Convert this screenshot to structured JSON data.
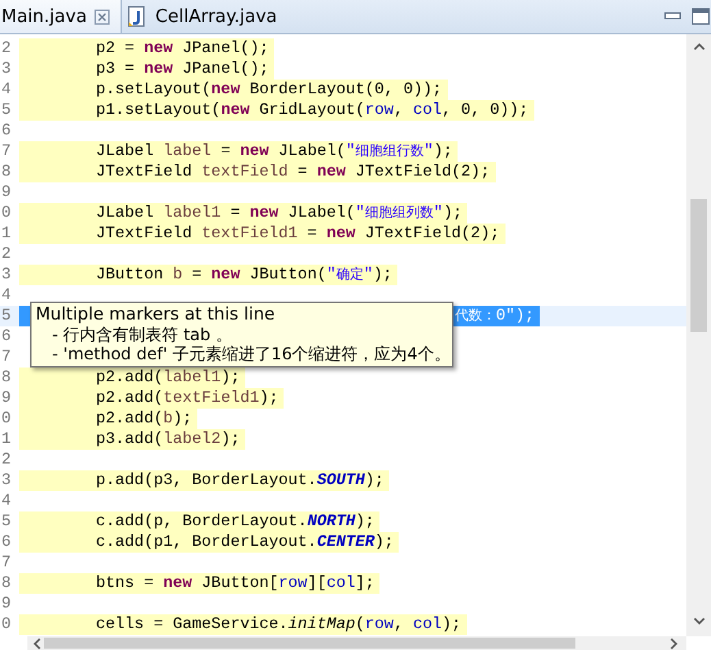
{
  "tabs": [
    {
      "label": "Main.java",
      "selected": true
    },
    {
      "label": "CellArray.java",
      "selected": false
    }
  ],
  "editor": {
    "lines": [
      {
        "number": "2",
        "highlighted": true,
        "selected": false,
        "code": [
          {
            "kind": "text",
            "t": "p2 = "
          },
          {
            "kind": "keyword",
            "t": "new"
          },
          {
            "kind": "text",
            "t": " JPanel();"
          }
        ]
      },
      {
        "number": "3",
        "highlighted": true,
        "selected": false,
        "code": [
          {
            "kind": "text",
            "t": "p3 = "
          },
          {
            "kind": "keyword",
            "t": "new"
          },
          {
            "kind": "text",
            "t": " JPanel();"
          }
        ]
      },
      {
        "number": "4",
        "highlighted": true,
        "selected": false,
        "code": [
          {
            "kind": "text",
            "t": "p.setLayout("
          },
          {
            "kind": "keyword",
            "t": "new"
          },
          {
            "kind": "text",
            "t": " BorderLayout(0, 0));"
          }
        ]
      },
      {
        "number": "5",
        "highlighted": true,
        "selected": false,
        "code": [
          {
            "kind": "text",
            "t": "p1.setLayout("
          },
          {
            "kind": "keyword",
            "t": "new"
          },
          {
            "kind": "text",
            "t": " GridLayout("
          },
          {
            "kind": "field",
            "t": "row"
          },
          {
            "kind": "text",
            "t": ", "
          },
          {
            "kind": "field",
            "t": "col"
          },
          {
            "kind": "text",
            "t": ", 0, 0));"
          }
        ]
      },
      {
        "number": "6"
      },
      {
        "number": "7",
        "highlighted": true,
        "selected": false,
        "code": [
          {
            "kind": "text",
            "t": "JLabel "
          },
          {
            "kind": "local",
            "t": "label"
          },
          {
            "kind": "text",
            "t": " = "
          },
          {
            "kind": "keyword",
            "t": "new"
          },
          {
            "kind": "text",
            "t": " JLabel("
          },
          {
            "kind": "string",
            "t": "\""
          },
          {
            "kind": "cjk",
            "t": "细胞组行数"
          },
          {
            "kind": "string",
            "t": "\""
          },
          {
            "kind": "text",
            "t": ");"
          }
        ]
      },
      {
        "number": "8",
        "highlighted": true,
        "selected": false,
        "code": [
          {
            "kind": "text",
            "t": "JTextField "
          },
          {
            "kind": "local",
            "t": "textField"
          },
          {
            "kind": "text",
            "t": " = "
          },
          {
            "kind": "keyword",
            "t": "new"
          },
          {
            "kind": "text",
            "t": " JTextField(2);"
          }
        ]
      },
      {
        "number": "9"
      },
      {
        "number": "0",
        "highlighted": true,
        "selected": false,
        "code": [
          {
            "kind": "text",
            "t": "JLabel "
          },
          {
            "kind": "local",
            "t": "label1"
          },
          {
            "kind": "text",
            "t": " = "
          },
          {
            "kind": "keyword",
            "t": "new"
          },
          {
            "kind": "text",
            "t": " JLabel("
          },
          {
            "kind": "string",
            "t": "\""
          },
          {
            "kind": "cjk",
            "t": "细胞组列数"
          },
          {
            "kind": "string",
            "t": "\""
          },
          {
            "kind": "text",
            "t": ");"
          }
        ]
      },
      {
        "number": "1",
        "highlighted": true,
        "selected": false,
        "code": [
          {
            "kind": "text",
            "t": "JTextField "
          },
          {
            "kind": "local",
            "t": "textField1"
          },
          {
            "kind": "text",
            "t": " = "
          },
          {
            "kind": "keyword",
            "t": "new"
          },
          {
            "kind": "text",
            "t": " JTextField(2);"
          }
        ]
      },
      {
        "number": "2"
      },
      {
        "number": "3",
        "highlighted": true,
        "selected": false,
        "code": [
          {
            "kind": "text",
            "t": "JButton "
          },
          {
            "kind": "local",
            "t": "b"
          },
          {
            "kind": "text",
            "t": " = "
          },
          {
            "kind": "keyword",
            "t": "new"
          },
          {
            "kind": "text",
            "t": " JButton("
          },
          {
            "kind": "string",
            "t": "\""
          },
          {
            "kind": "cjk",
            "t": "确定"
          },
          {
            "kind": "string",
            "t": "\""
          },
          {
            "kind": "text",
            "t": ");"
          }
        ]
      },
      {
        "number": "4"
      },
      {
        "number": "5",
        "highlighted": true,
        "selected": true,
        "covered": true,
        "code": [
          {
            "kind": "cjk",
            "t": "代数："
          },
          {
            "kind": "string",
            "t": "0\""
          },
          {
            "kind": "text",
            "t": ");"
          }
        ]
      },
      {
        "number": "6"
      },
      {
        "number": "7"
      },
      {
        "number": "8",
        "highlighted": true,
        "selected": false,
        "code": [
          {
            "kind": "text",
            "t": "p2.add("
          },
          {
            "kind": "local",
            "t": "label1"
          },
          {
            "kind": "text",
            "t": ");"
          }
        ]
      },
      {
        "number": "9",
        "highlighted": true,
        "selected": false,
        "code": [
          {
            "kind": "text",
            "t": "p2.add("
          },
          {
            "kind": "local",
            "t": "textField1"
          },
          {
            "kind": "text",
            "t": ");"
          }
        ]
      },
      {
        "number": "0",
        "highlighted": true,
        "selected": false,
        "code": [
          {
            "kind": "text",
            "t": "p2.add("
          },
          {
            "kind": "local",
            "t": "b"
          },
          {
            "kind": "text",
            "t": ");"
          }
        ]
      },
      {
        "number": "1",
        "highlighted": true,
        "selected": false,
        "code": [
          {
            "kind": "text",
            "t": "p3.add("
          },
          {
            "kind": "local",
            "t": "label2"
          },
          {
            "kind": "text",
            "t": ");"
          }
        ]
      },
      {
        "number": "2"
      },
      {
        "number": "3",
        "highlighted": true,
        "selected": false,
        "code": [
          {
            "kind": "text",
            "t": "p.add(p3, BorderLayout."
          },
          {
            "kind": "constant",
            "t": "SOUTH"
          },
          {
            "kind": "text",
            "t": ");"
          }
        ]
      },
      {
        "number": "4"
      },
      {
        "number": "5",
        "highlighted": true,
        "selected": false,
        "code": [
          {
            "kind": "text",
            "t": "c.add(p, BorderLayout."
          },
          {
            "kind": "constant",
            "t": "NORTH"
          },
          {
            "kind": "text",
            "t": ");"
          }
        ]
      },
      {
        "number": "6",
        "highlighted": true,
        "selected": false,
        "code": [
          {
            "kind": "text",
            "t": "c.add(p1, BorderLayout."
          },
          {
            "kind": "constant",
            "t": "CENTER"
          },
          {
            "kind": "text",
            "t": ");"
          }
        ]
      },
      {
        "number": "7"
      },
      {
        "number": "8",
        "highlighted": true,
        "selected": false,
        "code": [
          {
            "kind": "text",
            "t": "btns = "
          },
          {
            "kind": "keyword",
            "t": "new"
          },
          {
            "kind": "text",
            "t": " JButton["
          },
          {
            "kind": "field",
            "t": "row"
          },
          {
            "kind": "text",
            "t": "]["
          },
          {
            "kind": "field",
            "t": "col"
          },
          {
            "kind": "text",
            "t": "];"
          }
        ]
      },
      {
        "number": "9"
      },
      {
        "number": "0",
        "highlighted": true,
        "selected": false,
        "code": [
          {
            "kind": "text",
            "t": "cells = GameService."
          },
          {
            "kind": "static-method",
            "t": "initMap"
          },
          {
            "kind": "text",
            "t": "("
          },
          {
            "kind": "field",
            "t": "row"
          },
          {
            "kind": "text",
            "t": ", "
          },
          {
            "kind": "field",
            "t": "col"
          },
          {
            "kind": "text",
            "t": ");"
          }
        ]
      }
    ]
  },
  "tooltip": {
    "title": "Multiple markers at this line",
    "items": [
      "- 行内含有制表符 tab 。",
      "- 'method def' 子元素缩进了16个缩进符，应为4个。"
    ]
  }
}
